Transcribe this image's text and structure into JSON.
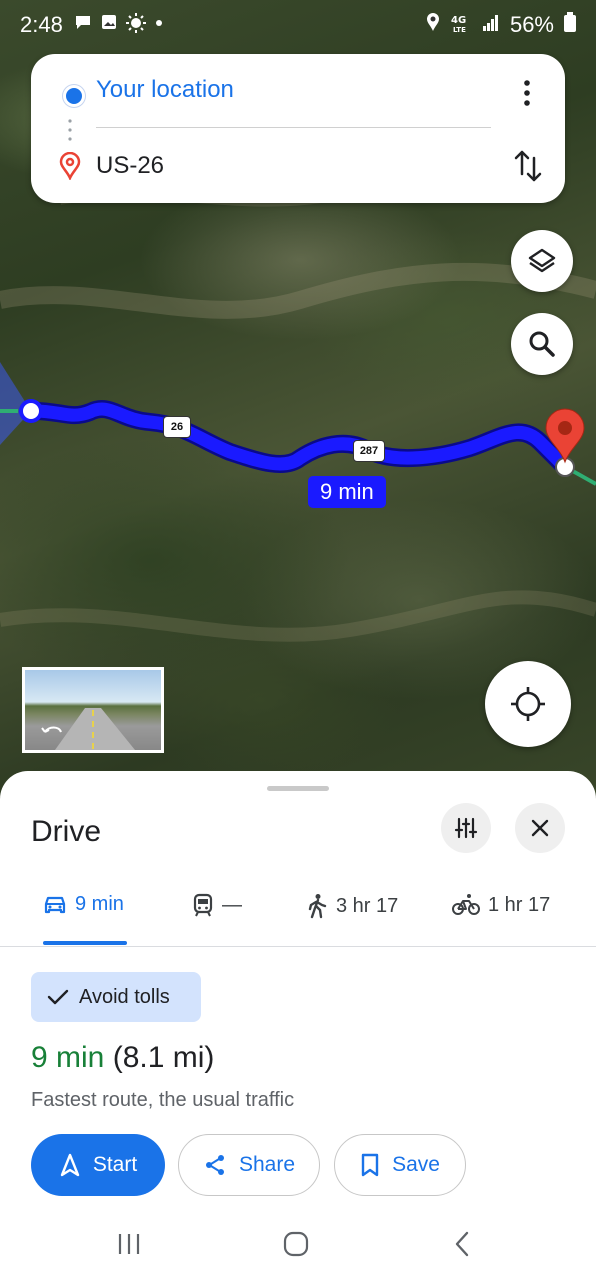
{
  "status_bar": {
    "time": "2:48",
    "network": "4G LTE",
    "battery": "56%",
    "left_icons": [
      "message-icon",
      "image-icon",
      "brightness-icon",
      "dot-icon"
    ],
    "right_icons": [
      "location-icon",
      "lte-icon",
      "signal-icon",
      "battery-icon"
    ]
  },
  "directions": {
    "origin": "Your location",
    "destination": "US-26"
  },
  "map": {
    "route_color": "#1a1aff",
    "road_label": "9 min",
    "shields": [
      "26",
      "287"
    ]
  },
  "sheet": {
    "title": "Drive",
    "modes": [
      {
        "icon": "car-icon",
        "label": "9 min",
        "active": true
      },
      {
        "icon": "transit-icon",
        "label": "—",
        "active": false
      },
      {
        "icon": "walk-icon",
        "label": "3 hr 17",
        "active": false
      },
      {
        "icon": "bike-icon",
        "label": "1 hr 17",
        "active": false
      }
    ],
    "chip_label": "Avoid tolls",
    "eta_time": "9 min",
    "eta_distance": "(8.1 mi)",
    "route_description": "Fastest route, the usual traffic",
    "buttons": {
      "start": "Start",
      "share": "Share",
      "save": "Save"
    }
  },
  "colors": {
    "accent": "#1a73e8",
    "eta_green": "#188038",
    "pin_red": "#ea4335"
  }
}
